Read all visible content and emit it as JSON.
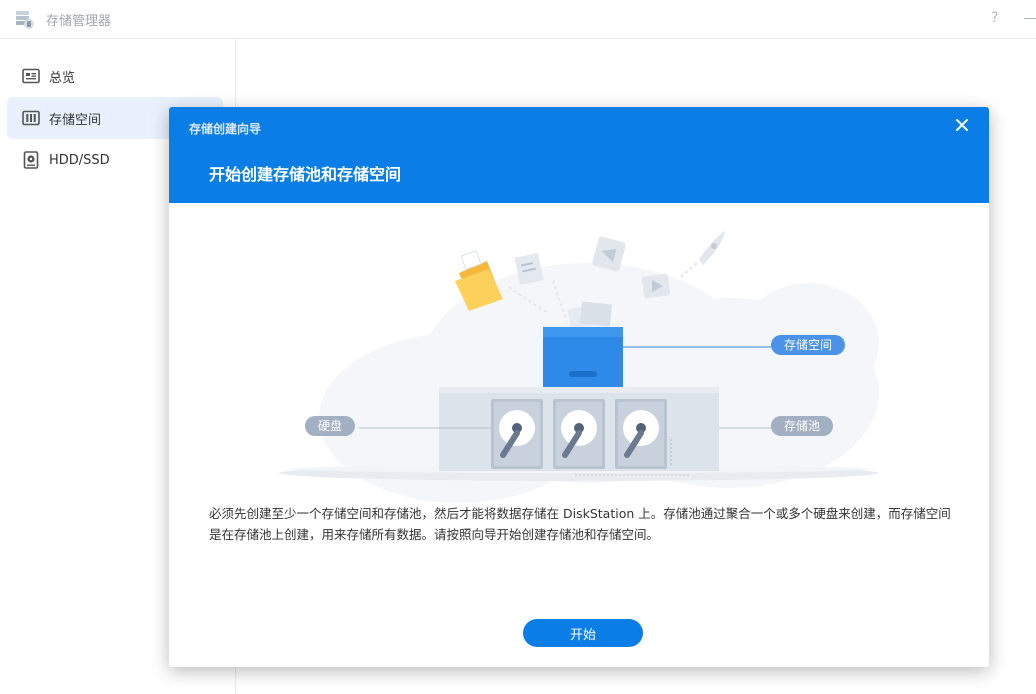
{
  "app": {
    "title": "存储管理器",
    "help_label": "?"
  },
  "sidebar": {
    "items": [
      {
        "label": "总览",
        "icon": "overview-icon",
        "active": false
      },
      {
        "label": "存储空间",
        "icon": "storage-volume-icon",
        "active": true
      },
      {
        "label": "HDD/SSD",
        "icon": "hdd-icon",
        "active": false
      }
    ]
  },
  "dialog": {
    "window_title": "存储创建向导",
    "heading": "开始创建存储池和存储空间",
    "illustration": {
      "label_volume": "存储空间",
      "label_pool": "存储池",
      "label_disk": "硬盘"
    },
    "description": "必须先创建至少一个存储空间和存储池，然后才能将数据存储在 DiskStation 上。存储池通过聚合一个或多个硬盘来创建，而存储空间是在存储池上创建，用来存储所有数据。请按照向导开始创建存储池和存储空间。",
    "start_button": "开始"
  },
  "colors": {
    "accent": "#0a7de6",
    "sidebar_active_bg": "#e8f1fd",
    "label_pill_blue": "#4a93e8",
    "label_pill_gray": "#a3afc2"
  }
}
